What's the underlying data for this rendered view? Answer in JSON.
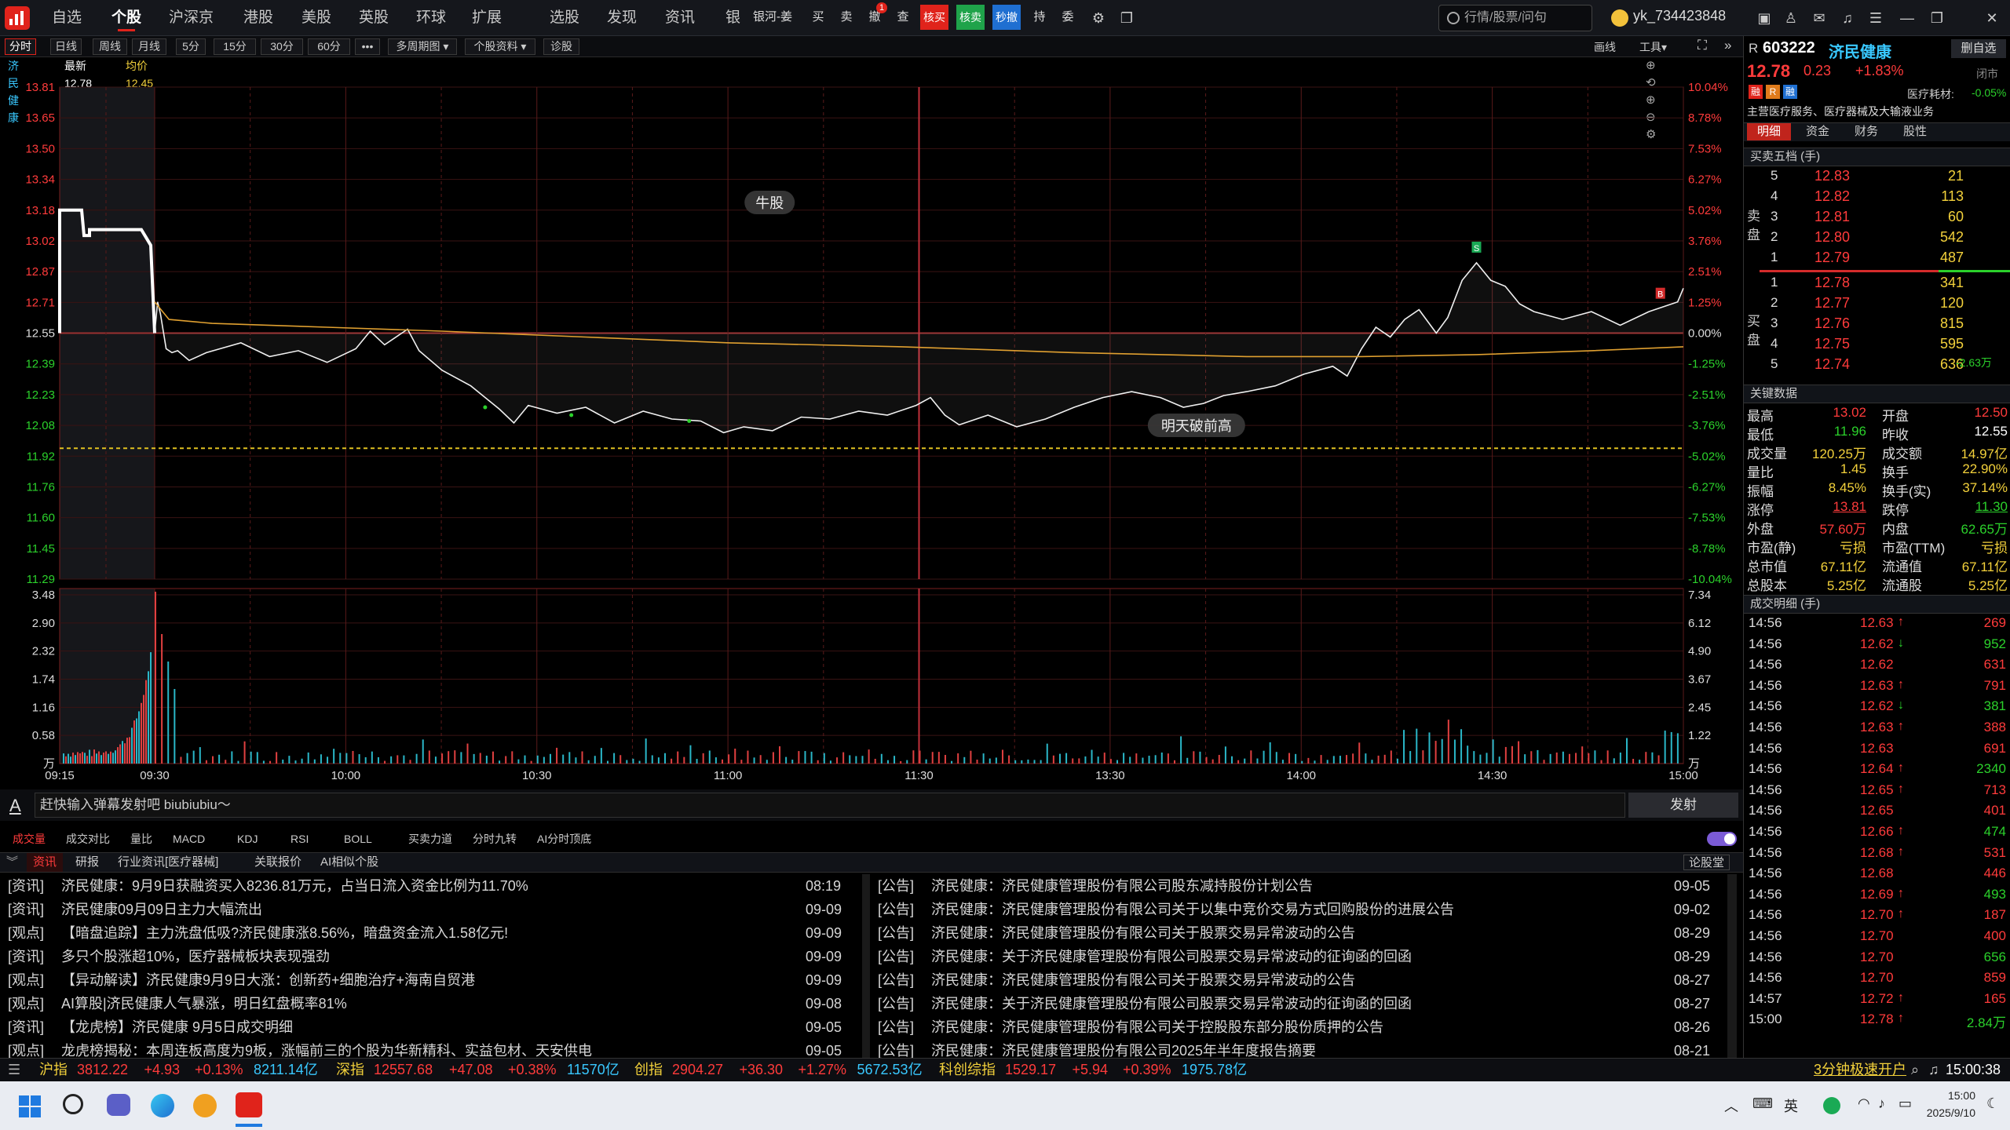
{
  "topnav": [
    "自选",
    "个股",
    "沪深京",
    "港股",
    "美股",
    "英股",
    "环球",
    "扩展",
    "选股",
    "发现",
    "资讯",
    "银行"
  ],
  "trade": {
    "broker": "银河-姜",
    "buy": "买",
    "sell": "卖",
    "cancel": "撤",
    "query": "查",
    "reverse_buy": "核买",
    "reverse_sell": "核卖",
    "flash_cancel": "秒撤",
    "hold": "持",
    "entrust": "委",
    "cancel_badge": "1"
  },
  "search_placeholder": "行情/股票/问句",
  "username": "yk_734423848",
  "periods": [
    "分时",
    "日线",
    "周线",
    "月线",
    "5分",
    "15分",
    "30分",
    "60分",
    "•••",
    "多周期图 ▾",
    "个股资料 ▾",
    "诊股"
  ],
  "draw_tools": {
    "draw": "画线",
    "tools": "工具▾"
  },
  "info": {
    "name": "济民健康",
    "last": "最新12.78",
    "avg": "均价12.45"
  },
  "chart_data": {
    "type": "line",
    "title": "",
    "price_axis": [
      "13.81",
      "13.65",
      "13.50",
      "13.34",
      "13.18",
      "13.02",
      "12.87",
      "12.71",
      "12.55",
      "12.39",
      "12.23",
      "12.08",
      "11.92",
      "11.76",
      "11.60",
      "11.45",
      "11.29"
    ],
    "pct_axis": [
      "10.04%",
      "8.78%",
      "7.53%",
      "6.27%",
      "5.02%",
      "3.76%",
      "2.51%",
      "1.25%",
      "0.00%",
      "-1.25%",
      "-2.51%",
      "-3.76%",
      "-5.02%",
      "-6.27%",
      "-7.53%",
      "-8.78%",
      "-10.04%"
    ],
    "vol_axis_left": [
      "3.48",
      "2.90",
      "2.32",
      "1.74",
      "1.16",
      "0.58",
      "万"
    ],
    "vol_axis_right": [
      "7.34",
      "6.12",
      "4.90",
      "3.67",
      "2.45",
      "1.22",
      "万"
    ],
    "time_axis": [
      "09:15",
      "09:30",
      "10:00",
      "10:30",
      "11:00",
      "11:30",
      "13:30",
      "14:00",
      "14:30",
      "15:00"
    ],
    "prev_close": 12.55,
    "ylim": [
      11.29,
      13.81
    ],
    "price_points": [
      [
        0,
        12.55
      ],
      [
        1,
        12.71
      ],
      [
        2,
        12.65
      ],
      [
        4,
        12.47
      ],
      [
        6,
        12.45
      ],
      [
        8,
        12.46
      ],
      [
        12,
        12.41
      ],
      [
        18,
        12.45
      ],
      [
        30,
        12.5
      ],
      [
        40,
        12.43
      ],
      [
        50,
        12.46
      ],
      [
        60,
        12.4
      ],
      [
        70,
        12.47
      ],
      [
        75,
        12.56
      ],
      [
        80,
        12.49
      ],
      [
        88,
        12.57
      ],
      [
        92,
        12.46
      ],
      [
        100,
        12.36
      ],
      [
        110,
        12.28
      ],
      [
        120,
        12.16
      ],
      [
        125,
        12.09
      ],
      [
        130,
        12.18
      ],
      [
        140,
        12.14
      ],
      [
        150,
        12.17
      ],
      [
        160,
        12.09
      ],
      [
        170,
        12.15
      ],
      [
        180,
        12.11
      ],
      [
        190,
        12.1
      ],
      [
        198,
        12.04
      ],
      [
        205,
        12.07
      ],
      [
        215,
        12.05
      ],
      [
        225,
        12.12
      ],
      [
        235,
        12.11
      ],
      [
        245,
        12.15
      ],
      [
        255,
        12.13
      ],
      [
        265,
        12.18
      ],
      [
        270,
        12.22
      ],
      [
        275,
        12.13
      ],
      [
        280,
        12.08
      ],
      [
        290,
        12.13
      ],
      [
        300,
        12.07
      ],
      [
        310,
        12.11
      ],
      [
        320,
        12.17
      ],
      [
        330,
        12.22
      ],
      [
        340,
        12.25
      ],
      [
        350,
        12.22
      ],
      [
        358,
        12.17
      ],
      [
        365,
        12.19
      ],
      [
        372,
        12.23
      ],
      [
        380,
        12.25
      ],
      [
        390,
        12.28
      ],
      [
        400,
        12.34
      ],
      [
        410,
        12.38
      ],
      [
        415,
        12.33
      ],
      [
        420,
        12.47
      ],
      [
        425,
        12.58
      ],
      [
        430,
        12.53
      ],
      [
        435,
        12.62
      ],
      [
        440,
        12.67
      ],
      [
        446,
        12.55
      ],
      [
        450,
        12.63
      ],
      [
        455,
        12.82
      ],
      [
        460,
        12.91
      ],
      [
        465,
        12.82
      ],
      [
        470,
        12.79
      ],
      [
        475,
        12.7
      ],
      [
        480,
        12.66
      ],
      [
        490,
        12.62
      ],
      [
        500,
        12.66
      ],
      [
        510,
        12.59
      ],
      [
        520,
        12.66
      ],
      [
        530,
        12.71
      ],
      [
        532,
        12.78
      ]
    ],
    "avg_points": [
      [
        0,
        12.71
      ],
      [
        5,
        12.62
      ],
      [
        20,
        12.6
      ],
      [
        60,
        12.58
      ],
      [
        100,
        12.56
      ],
      [
        150,
        12.53
      ],
      [
        200,
        12.5
      ],
      [
        260,
        12.48
      ],
      [
        320,
        12.45
      ],
      [
        380,
        12.43
      ],
      [
        420,
        12.43
      ],
      [
        460,
        12.44
      ],
      [
        500,
        12.46
      ],
      [
        532,
        12.48
      ]
    ],
    "low_line": 11.96,
    "annotations": [
      "牛股",
      "明天破前高"
    ],
    "marks": {
      "sell": "S",
      "buy": "B"
    }
  },
  "danmu": {
    "icon": "A",
    "placeholder": "赶快输入弹幕发射吧 biubiubiu～",
    "send": "发射"
  },
  "indicators": [
    "成交量",
    "成交对比",
    "量比",
    "MACD",
    "KDJ",
    "RSI",
    "BOLL",
    "买卖力道",
    "分时九转",
    "AI分时顶底"
  ],
  "newstabs": [
    "资讯",
    "研报",
    "行业资讯[医疗器械]",
    "关联报价",
    "AI相似个股"
  ],
  "news_btn": "论股堂",
  "news_left": [
    [
      "[资讯]",
      "济民健康：9月9日获融资买入8236.81万元，占当日流入资金比例为11.70%",
      "08:19"
    ],
    [
      "[资讯]",
      "济民健康09月09日主力大幅流出",
      "09-09"
    ],
    [
      "[观点]",
      "【暗盘追踪】主力洗盘低吸?济民健康涨8.56%，暗盘资金流入1.58亿元!",
      "09-09"
    ],
    [
      "[资讯]",
      "多只个股涨超10%，医疗器械板块表现强劲",
      "09-09"
    ],
    [
      "[观点]",
      "【异动解读】济民健康9月9日大涨：创新药+细胞治疗+海南自贸港",
      "09-09"
    ],
    [
      "[观点]",
      "AI算股|济民健康人气暴涨，明日红盘概率81%",
      "09-08"
    ],
    [
      "[资讯]",
      "【龙虎榜】济民健康 9月5日成交明细",
      "09-05"
    ],
    [
      "[观点]",
      "龙虎榜揭秘：本周连板高度为9板，涨幅前三的个股为华新精科、实益包材、天安供电",
      "09-05"
    ]
  ],
  "news_right": [
    [
      "[公告]",
      "济民健康：济民健康管理股份有限公司股东减持股份计划公告",
      "09-05"
    ],
    [
      "[公告]",
      "济民健康：济民健康管理股份有限公司关于以集中竞价交易方式回购股份的进展公告",
      "09-02"
    ],
    [
      "[公告]",
      "济民健康：济民健康管理股份有限公司关于股票交易异常波动的公告",
      "08-29"
    ],
    [
      "[公告]",
      "济民健康：关于济民健康管理股份有限公司股票交易异常波动的征询函的回函",
      "08-29"
    ],
    [
      "[公告]",
      "济民健康：济民健康管理股份有限公司关于股票交易异常波动的公告",
      "08-27"
    ],
    [
      "[公告]",
      "济民健康：关于济民健康管理股份有限公司股票交易异常波动的征询函的回函",
      "08-27"
    ],
    [
      "[公告]",
      "济民健康：济民健康管理股份有限公司关于控股股东部分股份质押的公告",
      "08-26"
    ],
    [
      "[公告]",
      "济民健康：济民健康管理股份有限公司2025年半年度报告摘要",
      "08-21"
    ]
  ],
  "stock": {
    "r": "R",
    "code": "603222",
    "name": "济民健康",
    "watch": "删自选",
    "price": "12.78",
    "chg": "0.23",
    "pct": "+1.83%",
    "status": "闭市",
    "tags": [
      "融",
      "R",
      "融"
    ],
    "sector": "医疗耗材:",
    "sector_pct": "-0.05%",
    "business": "主营医疗服务、医疗器械及大输液业务"
  },
  "rtabs": [
    "明细",
    "资金",
    "财务",
    "股性"
  ],
  "order_title": "买卖五档 (手)",
  "asks": [
    [
      "5",
      "12.83",
      "21"
    ],
    [
      "4",
      "12.82",
      "113"
    ],
    [
      "3",
      "12.81",
      "60"
    ],
    [
      "2",
      "12.80",
      "542"
    ],
    [
      "1",
      "12.79",
      "487"
    ]
  ],
  "bids": [
    [
      "1",
      "12.78",
      "341"
    ],
    [
      "2",
      "12.77",
      "120"
    ],
    [
      "3",
      "12.76",
      "815"
    ],
    [
      "4",
      "12.75",
      "595"
    ],
    [
      "5",
      "12.74",
      "636"
    ]
  ],
  "sell_label": "卖盘",
  "buy_label": "买盘",
  "bid_note": "-2.63万",
  "key_title": "关键数据",
  "keydata": [
    [
      "最高",
      "13.02",
      "开盘",
      "12.50"
    ],
    [
      "最低",
      "11.96",
      "昨收",
      "12.55"
    ],
    [
      "成交量",
      "120.25万",
      "成交额",
      "14.97亿"
    ],
    [
      "量比",
      "1.45",
      "换手",
      "22.90%"
    ],
    [
      "振幅",
      "8.45%",
      "换手(实)",
      "37.14%"
    ],
    [
      "涨停",
      "13.81",
      "跌停",
      "11.30"
    ],
    [
      "外盘",
      "57.60万",
      "内盘",
      "62.65万"
    ],
    [
      "市盈(静)",
      "亏损",
      "市盈(TTM)",
      "亏损"
    ],
    [
      "总市值",
      "67.11亿",
      "流通值",
      "67.11亿"
    ],
    [
      "总股本",
      "5.25亿",
      "流通股",
      "5.25亿"
    ]
  ],
  "trades_title": "成交明细 (手)",
  "trades": [
    [
      "14:56",
      "12.63",
      "↑",
      "269"
    ],
    [
      "14:56",
      "12.62",
      "↓",
      "952"
    ],
    [
      "14:56",
      "12.62",
      "",
      "631"
    ],
    [
      "14:56",
      "12.63",
      "↑",
      "791"
    ],
    [
      "14:56",
      "12.62",
      "↓",
      "381"
    ],
    [
      "14:56",
      "12.63",
      "↑",
      "388"
    ],
    [
      "14:56",
      "12.63",
      "",
      "691"
    ],
    [
      "14:56",
      "12.64",
      "↑",
      "2340"
    ],
    [
      "14:56",
      "12.65",
      "↑",
      "713"
    ],
    [
      "14:56",
      "12.65",
      "",
      "401"
    ],
    [
      "14:56",
      "12.66",
      "↑",
      "474"
    ],
    [
      "14:56",
      "12.68",
      "↑",
      "531"
    ],
    [
      "14:56",
      "12.68",
      "",
      "446"
    ],
    [
      "14:56",
      "12.69",
      "↑",
      "493"
    ],
    [
      "14:56",
      "12.70",
      "↑",
      "187"
    ],
    [
      "14:56",
      "12.70",
      "",
      "400"
    ],
    [
      "14:56",
      "12.70",
      "",
      "656"
    ],
    [
      "14:56",
      "12.70",
      "",
      "859"
    ],
    [
      "14:57",
      "12.72",
      "↑",
      "165"
    ],
    [
      "15:00",
      "12.78",
      "↑",
      "2.84万"
    ]
  ],
  "status": [
    [
      "沪指",
      "3812.22",
      "+4.93",
      "+0.13%",
      "8211.14亿"
    ],
    [
      "深指",
      "12557.68",
      "+47.08",
      "+0.38%",
      "11570亿"
    ],
    [
      "创指",
      "2904.27",
      "+36.30",
      "+1.27%",
      "5672.53亿"
    ],
    [
      "科创综指",
      "1529.17",
      "+5.94",
      "+0.39%",
      "1975.78亿"
    ]
  ],
  "promo": "3分钟极速开户",
  "clock": "15:00:38",
  "taskbar": {
    "ime": "英",
    "time": "15:00",
    "date": "2025/9/10"
  }
}
